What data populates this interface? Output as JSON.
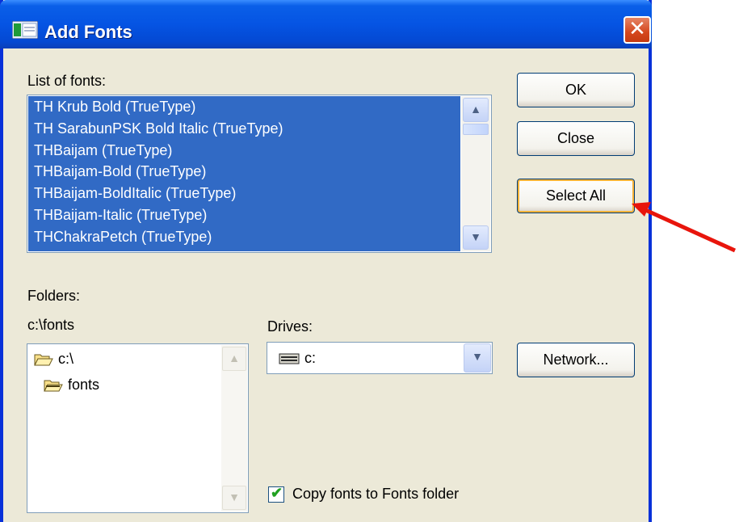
{
  "window": {
    "title": "Add Fonts",
    "close_glyph": "✕"
  },
  "list_of_fonts": {
    "label": "List of fonts:",
    "items": [
      "TH Krub Bold (TrueType)",
      "TH SarabunPSK Bold Italic (TrueType)",
      "THBaijam (TrueType)",
      "THBaijam-Bold (TrueType)",
      "THBaijam-BoldItalic (TrueType)",
      "THBaijam-Italic (TrueType)",
      "THChakraPetch (TrueType)"
    ],
    "all_selected": true
  },
  "buttons": {
    "ok": "OK",
    "close": "Close",
    "select_all": "Select All",
    "network": "Network..."
  },
  "folders": {
    "label": "Folders:",
    "current_path": "c:\\fonts",
    "tree": [
      "c:\\",
      "fonts"
    ]
  },
  "drives": {
    "label": "Drives:",
    "selected": "c:"
  },
  "copy_option": {
    "label": "Copy fonts to Fonts folder",
    "checked": true
  },
  "icons": {
    "app": "font-dialog-icon",
    "folder_open": "folder-open-icon",
    "drive": "hard-drive-icon",
    "annotation": "red-arrow-annotation"
  },
  "colors": {
    "titlebar": "#0554e3",
    "selection": "#316ac5",
    "dialog_bg": "#ece9d8",
    "annotation": "#e8150c"
  }
}
